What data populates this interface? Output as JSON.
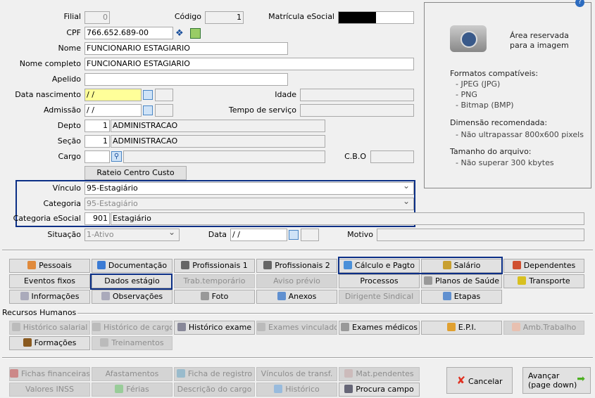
{
  "form": {
    "filial_label": "Filial",
    "filial": "0",
    "codigo_label": "Código",
    "codigo": "1",
    "matricula_label": "Matrícula eSocial",
    "cpf_label": "CPF",
    "cpf": "766.652.689-00",
    "nome_label": "Nome",
    "nome": "FUNCIONARIO ESTAGIARIO",
    "nome_completo_label": "Nome completo",
    "nome_completo": "FUNCIONARIO ESTAGIARIO",
    "apelido_label": "Apelido",
    "apelido": "",
    "nascimento_label": "Data nascimento",
    "nascimento": " / /",
    "idade_label": "Idade",
    "admissao_label": "Admissão",
    "admissao": " / /",
    "tempo_label": "Tempo de serviço",
    "depto_label": "Depto",
    "depto_code": "1",
    "depto": "ADMINISTRACAO",
    "secao_label": "Seção",
    "secao_code": "1",
    "secao": "ADMINISTRACAO",
    "cargo_label": "Cargo",
    "cbo_label": "C.B.O",
    "rateio_button": "Rateio Centro Custo",
    "vinculo_label": "Vínculo",
    "vinculo": "95-Estagiário",
    "categoria_label": "Categoria",
    "categoria": "95-Estagiário",
    "cat_esocial_label": "Categoria eSocial",
    "cat_esocial_code": "901",
    "cat_esocial": "Estagiário",
    "situacao_label": "Situação",
    "situacao": "1-Ativo",
    "data_label": "Data",
    "data": " / /",
    "motivo_label": "Motivo"
  },
  "image_panel": {
    "reserved": "Área reservada",
    "reserved2": "para a imagem",
    "formats_title": "Formatos compatíveis:",
    "formats": [
      "- JPEG (JPG)",
      "- PNG",
      "- Bitmap (BMP)"
    ],
    "dim_title": "Dimensão recomendada:",
    "dim": "- Não ultrapassar 800x600 pixels",
    "size_title": "Tamanho do arquivo:",
    "size": "- Não superar 300 kbytes"
  },
  "section_rh": "Recursos Humanos",
  "buttons": [
    {
      "label": "Pessoais",
      "row": 0,
      "col": 0,
      "icon": "person-icon",
      "c": "#e08a3c"
    },
    {
      "label": "Documentação",
      "row": 0,
      "col": 1,
      "icon": "document-card-icon",
      "c": "#3a7bd5"
    },
    {
      "label": "Profissionais 1",
      "row": 0,
      "col": 2,
      "icon": "book-icon",
      "c": "#666"
    },
    {
      "label": "Profissionais 2",
      "row": 0,
      "col": 3,
      "icon": "book-icon",
      "c": "#666"
    },
    {
      "label": "Cálculo e Pagto",
      "row": 0,
      "col": 4,
      "icon": "calculator-icon",
      "c": "#4a90d9"
    },
    {
      "label": "Salário",
      "row": 0,
      "col": 5,
      "icon": "money-bag-icon",
      "c": "#c8a030"
    },
    {
      "label": "Dependentes",
      "row": 0,
      "col": 6,
      "icon": "people-icon",
      "c": "#d05030"
    },
    {
      "label": "Eventos fixos",
      "row": 1,
      "col": 0
    },
    {
      "label": "Dados estágio",
      "row": 1,
      "col": 1
    },
    {
      "label": "Trab.temporário",
      "row": 1,
      "col": 2,
      "off": true
    },
    {
      "label": "Aviso prévio",
      "row": 1,
      "col": 3,
      "off": true
    },
    {
      "label": "Processos",
      "row": 1,
      "col": 4
    },
    {
      "label": "Planos de Saúde",
      "row": 1,
      "col": 5,
      "icon": "ambulance-icon",
      "c": "#999"
    },
    {
      "label": "Transporte",
      "row": 1,
      "col": 6,
      "icon": "bus-icon",
      "c": "#d8c020"
    },
    {
      "label": "Informações",
      "row": 2,
      "col": 0,
      "icon": "page-icon",
      "c": "#aab"
    },
    {
      "label": "Observações",
      "row": 2,
      "col": 1,
      "icon": "page-icon",
      "c": "#aab"
    },
    {
      "label": "Foto",
      "row": 2,
      "col": 2,
      "icon": "camera-icon",
      "c": "#999"
    },
    {
      "label": "Anexos",
      "row": 2,
      "col": 3,
      "icon": "paperclip-icon",
      "c": "#6090d0"
    },
    {
      "label": "Dirigente Sindical",
      "row": 2,
      "col": 4,
      "off": true
    },
    {
      "label": "Etapas",
      "row": 2,
      "col": 5,
      "icon": "checklist-icon",
      "c": "#6090d0"
    },
    {
      "label": "Histórico salarial",
      "row": 3,
      "col": 0,
      "off": true,
      "icon": "history-icon",
      "c": "#bbb"
    },
    {
      "label": "Histórico de cargo",
      "row": 3,
      "col": 1,
      "off": true,
      "icon": "history-icon",
      "c": "#bbb"
    },
    {
      "label": "Histórico exame",
      "row": 3,
      "col": 2,
      "icon": "history-icon",
      "c": "#889"
    },
    {
      "label": "Exames vinculados",
      "row": 3,
      "col": 3,
      "off": true,
      "icon": "history-icon",
      "c": "#bbb"
    },
    {
      "label": "Exames médicos",
      "row": 3,
      "col": 4,
      "icon": "ambulance-icon",
      "c": "#999"
    },
    {
      "label": "E.P.I.",
      "row": 3,
      "col": 5,
      "icon": "worker-icon",
      "c": "#e0a030"
    },
    {
      "label": "Amb.Trabalho",
      "row": 3,
      "col": 6,
      "off": true,
      "icon": "hands-icon",
      "c": "#e8c0b0"
    },
    {
      "label": "Formações",
      "row": 4,
      "col": 0,
      "icon": "graduation-cap-icon",
      "c": "#8a5a20"
    },
    {
      "label": "Treinamentos",
      "row": 4,
      "col": 1,
      "off": true,
      "icon": "history-icon",
      "c": "#bbb"
    },
    {
      "label": "Fichas financeiras",
      "row": 5,
      "col": 0,
      "off": true,
      "icon": "sheet-icon",
      "c": "#c88"
    },
    {
      "label": "Afastamentos",
      "row": 5,
      "col": 1,
      "off": true
    },
    {
      "label": "Ficha de registro",
      "row": 5,
      "col": 2,
      "off": true,
      "icon": "document-card-icon",
      "c": "#9bc"
    },
    {
      "label": "Vínculos de transf.",
      "row": 5,
      "col": 3,
      "off": true
    },
    {
      "label": "Mat.pendentes",
      "row": 5,
      "col": 4,
      "off": true,
      "icon": "tools-icon",
      "c": "#cbb"
    },
    {
      "label": "Valores INSS",
      "row": 6,
      "col": 0,
      "off": true
    },
    {
      "label": "Férias",
      "row": 6,
      "col": 1,
      "off": true,
      "icon": "landscape-icon",
      "c": "#9c9"
    },
    {
      "label": "Descrição do cargo",
      "row": 6,
      "col": 2,
      "off": true
    },
    {
      "label": "Histórico",
      "row": 6,
      "col": 3,
      "off": true,
      "icon": "clock-icon",
      "c": "#9bd"
    },
    {
      "label": "Procura campo",
      "row": 6,
      "col": 4,
      "icon": "binoculars-icon",
      "c": "#667"
    }
  ],
  "cancel_label": "Cancelar",
  "next_label": "Avançar",
  "next_sub": "(page down)"
}
